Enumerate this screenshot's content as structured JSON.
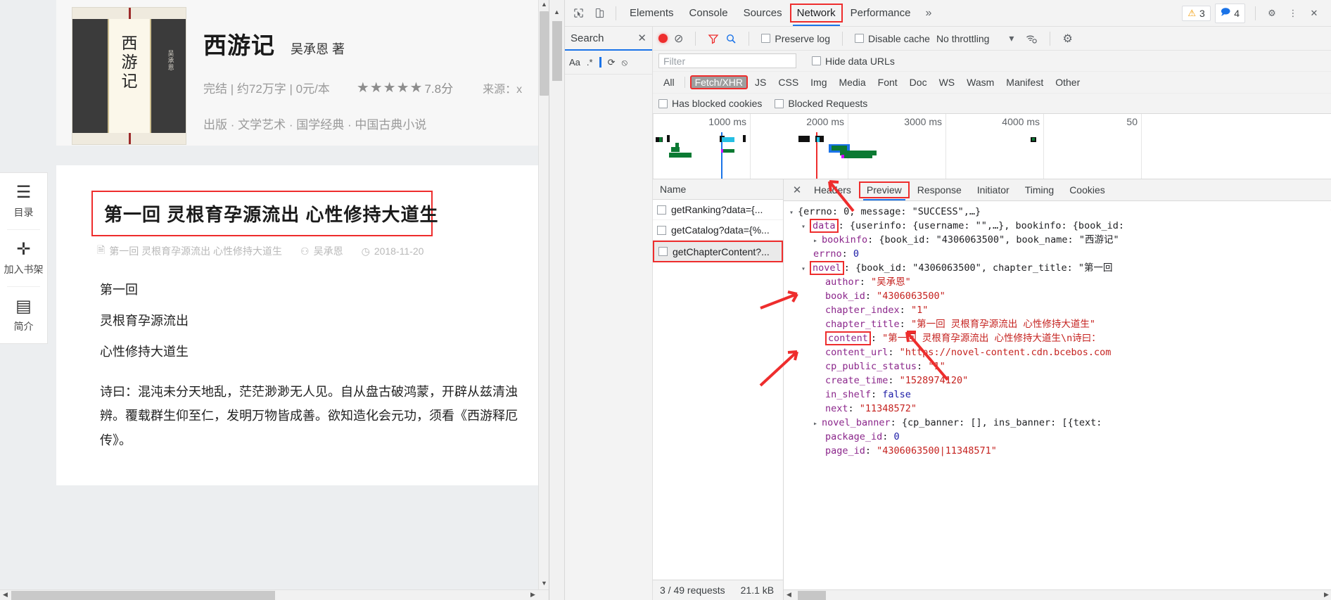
{
  "webpage": {
    "book": {
      "cover_title_chars": [
        "西",
        "游",
        "记"
      ],
      "cover_author": "吴承恩",
      "title": "西游记",
      "author_line": "吴承恩 著",
      "status_meta": "完结 | 约72万字 | 0元/本",
      "stars": "★★★★★",
      "score": "7.8分",
      "source": "来源：x",
      "categories": "出版 · 文学艺术 · 国学经典 · 中国古典小说"
    },
    "rail": [
      {
        "icon": "☰",
        "label": "目录",
        "name": "catalog"
      },
      {
        "icon": "✛",
        "label": "加入书架",
        "name": "add-to-shelf"
      },
      {
        "icon": "▤",
        "label": "简介",
        "name": "intro"
      }
    ],
    "chapter": {
      "title": "第一回 灵根育孕源流出 心性修持大道生",
      "sub_title": "第一回 灵根育孕源流出 心性修持大道生",
      "sub_author": "吴承恩",
      "sub_date": "2018-11-20",
      "icon_doc": "🗎",
      "icon_user": "⚇",
      "icon_clock": "◷",
      "lines": [
        "第一回",
        "灵根育孕源流出",
        "心性修持大道生"
      ],
      "paragraph": "诗曰：混沌未分天地乱，茫茫渺渺无人见。自从盘古破鸿蒙，开辟从兹清浊辨。覆载群生仰至仁，发明万物皆成善。欲知造化会元功，须看《西游释厄传》。"
    }
  },
  "devtools": {
    "tabs": [
      {
        "label": "Elements",
        "active": false,
        "boxed": false
      },
      {
        "label": "Console",
        "active": false,
        "boxed": false
      },
      {
        "label": "Sources",
        "active": false,
        "boxed": false
      },
      {
        "label": "Network",
        "active": true,
        "boxed": true
      },
      {
        "label": "Performance",
        "active": false,
        "boxed": false
      }
    ],
    "more_tabs_icon": "»",
    "warnings_count": "3",
    "info_count": "4",
    "gear_icon": "⚙",
    "kebab_icon": "⋮",
    "close_icon": "✕",
    "inspect_icon": "⬉",
    "device_icon": "▯",
    "search_panel": {
      "title": "Search",
      "close": "✕",
      "match_case": "Aa",
      "regex": ".*",
      "refresh": "⟳",
      "clear": "⦸"
    },
    "network_toolbar": {
      "record": "record-button",
      "clear": "⊘",
      "filter_icon": "filter",
      "search_icon": "search",
      "preserve_log": "Preserve log",
      "disable_cache": "Disable cache",
      "throttling": "No throttling",
      "throttle_caret": "▾",
      "wifi_icon": "wifi-settings",
      "settings_icon": "⚙",
      "import_icon": "↥",
      "export_icon": "↧"
    },
    "filter": {
      "placeholder": "Filter",
      "hide_data_urls": "Hide data URLs",
      "types": [
        "All",
        "Fetch/XHR",
        "JS",
        "CSS",
        "Img",
        "Media",
        "Font",
        "Doc",
        "WS",
        "Wasm",
        "Manifest",
        "Other"
      ],
      "active_type": "Fetch/XHR",
      "has_blocked_cookies": "Has blocked cookies",
      "blocked_requests": "Blocked Requests"
    },
    "overview": {
      "ticks": [
        "1000 ms",
        "2000 ms",
        "3000 ms",
        "4000 ms",
        "50"
      ]
    },
    "requests": {
      "column_header": "Name",
      "rows": [
        {
          "name": "getRanking?data={...",
          "selected": false
        },
        {
          "name": "getCatalog?data={%...",
          "selected": false
        },
        {
          "name": "getChapterContent?...",
          "selected": true
        }
      ],
      "footer_count": "3 / 49 requests",
      "footer_size": "21.1 kB"
    },
    "detail": {
      "tabs": [
        {
          "label": "Headers",
          "active": false,
          "boxed": false
        },
        {
          "label": "Preview",
          "active": true,
          "boxed": true
        },
        {
          "label": "Response",
          "active": false,
          "boxed": false
        },
        {
          "label": "Initiator",
          "active": false,
          "boxed": false
        },
        {
          "label": "Timing",
          "active": false,
          "boxed": false
        },
        {
          "label": "Cookies",
          "active": false,
          "boxed": false
        }
      ],
      "json_lines": [
        {
          "indent": 0,
          "tri": "▾",
          "key": "",
          "text": "{errno: 0, message: \"SUCCESS\",…}",
          "kind": "plain"
        },
        {
          "indent": 1,
          "tri": "▾",
          "key": "data",
          "boxed": true,
          "text": "{userinfo: {username: \"\",…}, bookinfo: {book_id:"
        },
        {
          "indent": 2,
          "tri": "▸",
          "key": "bookinfo",
          "text": "{book_id: \"4306063500\", book_name: \"西游记\""
        },
        {
          "indent": 2,
          "tri": "",
          "key": "errno",
          "text": "0",
          "kind": "num"
        },
        {
          "indent": 1,
          "tri": "▾",
          "key": "novel",
          "boxed": true,
          "text": "{book_id: \"4306063500\", chapter_title: \"第一回"
        },
        {
          "indent": 3,
          "tri": "",
          "key": "author",
          "text": "\"吴承恩\"",
          "kind": "str"
        },
        {
          "indent": 3,
          "tri": "",
          "key": "book_id",
          "text": "\"4306063500\"",
          "kind": "str"
        },
        {
          "indent": 3,
          "tri": "",
          "key": "chapter_index",
          "text": "\"1\"",
          "kind": "str"
        },
        {
          "indent": 3,
          "tri": "",
          "key": "chapter_title",
          "text": "\"第一回  灵根育孕源流出  心性修持大道生\"",
          "kind": "str"
        },
        {
          "indent": 3,
          "tri": "",
          "key": "content",
          "boxed": true,
          "text": "\"第一回  灵根育孕源流出  心性修持大道生\\n诗曰：",
          "kind": "str"
        },
        {
          "indent": 3,
          "tri": "",
          "key": "content_url",
          "text": "\"https://novel-content.cdn.bcebos.com",
          "kind": "str"
        },
        {
          "indent": 3,
          "tri": "",
          "key": "cp_public_status",
          "text": "\"1\"",
          "kind": "str"
        },
        {
          "indent": 3,
          "tri": "",
          "key": "create_time",
          "text": "\"1528974120\"",
          "kind": "str"
        },
        {
          "indent": 3,
          "tri": "",
          "key": "in_shelf",
          "text": "false",
          "kind": "bool"
        },
        {
          "indent": 3,
          "tri": "",
          "key": "next",
          "text": "\"11348572\"",
          "kind": "str"
        },
        {
          "indent": 2,
          "tri": "▸",
          "key": "novel_banner",
          "text": "{cp_banner: [], ins_banner: [{text:"
        },
        {
          "indent": 3,
          "tri": "",
          "key": "package_id",
          "text": "0",
          "kind": "num"
        },
        {
          "indent": 3,
          "tri": "",
          "key": "page_id",
          "text": "\"4306063500|11348571\"",
          "kind": "str"
        }
      ]
    }
  }
}
